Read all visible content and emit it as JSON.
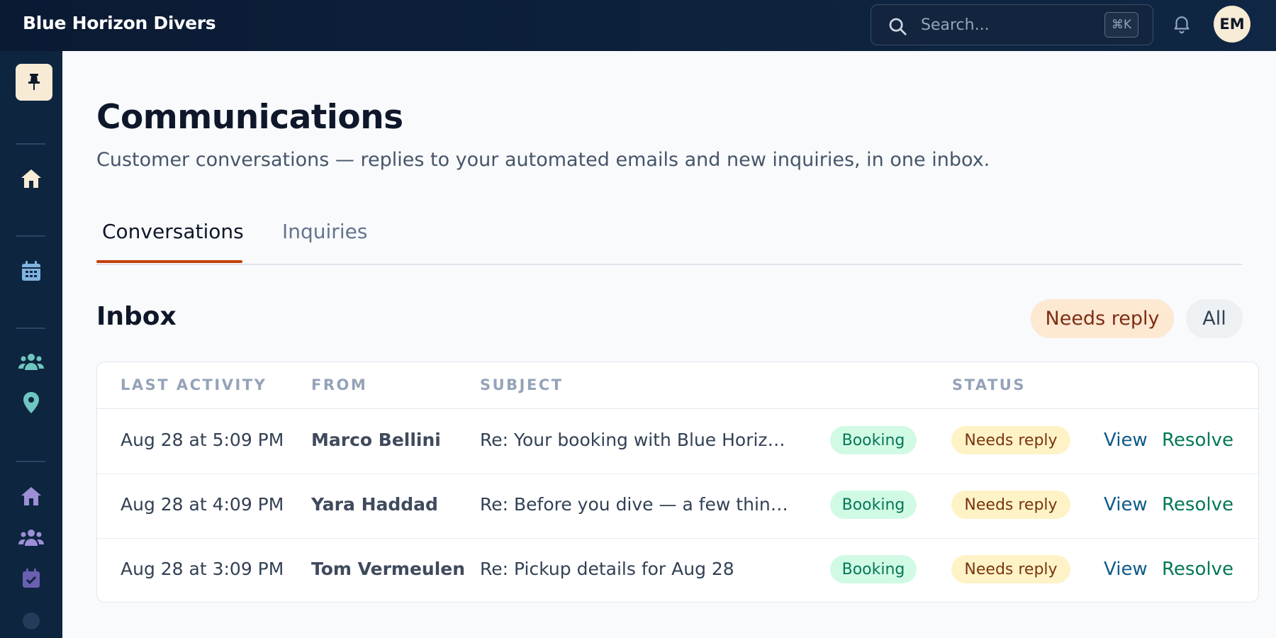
{
  "app": {
    "brand": "Blue Horizon Divers",
    "search_placeholder": "Search...",
    "search_shortcut": "⌘K",
    "avatar_initials": "EM"
  },
  "sidebar": {
    "items": [
      {
        "icon": "pin-icon"
      },
      {
        "icon": "home-icon"
      },
      {
        "icon": "calendar-icon"
      },
      {
        "icon": "users-icon"
      },
      {
        "icon": "location-pin-icon"
      },
      {
        "icon": "home-icon"
      },
      {
        "icon": "users-icon"
      },
      {
        "icon": "calendar-check-icon"
      }
    ]
  },
  "page": {
    "title": "Communications",
    "subtitle": "Customer conversations — replies to your automated emails and new inquiries, in one inbox."
  },
  "tabs": [
    {
      "label": "Conversations",
      "active": true
    },
    {
      "label": "Inquiries",
      "active": false
    }
  ],
  "inbox": {
    "title": "Inbox",
    "filters": [
      {
        "label": "Needs reply",
        "active": true
      },
      {
        "label": "All",
        "active": false
      }
    ]
  },
  "table": {
    "headers": {
      "last_activity": "LAST ACTIVITY",
      "from": "FROM",
      "subject": "SUBJECT",
      "status": "STATUS"
    },
    "rows": [
      {
        "last_activity": "Aug 28 at 5:09 PM",
        "from": "Marco Bellini",
        "subject": "Re: Your booking with Blue Horizon ...",
        "category": "Booking",
        "status": "Needs reply",
        "view": "View",
        "resolve": "Resolve"
      },
      {
        "last_activity": "Aug 28 at 4:09 PM",
        "from": "Yara Haddad",
        "subject": "Re: Before you dive — a few things t...",
        "category": "Booking",
        "status": "Needs reply",
        "view": "View",
        "resolve": "Resolve"
      },
      {
        "last_activity": "Aug 28 at 3:09 PM",
        "from": "Tom Vermeulen",
        "subject": "Re: Pickup details for Aug 28",
        "category": "Booking",
        "status": "Needs reply",
        "view": "View",
        "resolve": "Resolve"
      }
    ]
  },
  "colors": {
    "topbar": "#0b1a33",
    "sidebar": "#0e2540",
    "accent_tab": "#c2410c",
    "needs_reply_bg": "#fef3c7",
    "booking_bg": "#d1fae5"
  }
}
